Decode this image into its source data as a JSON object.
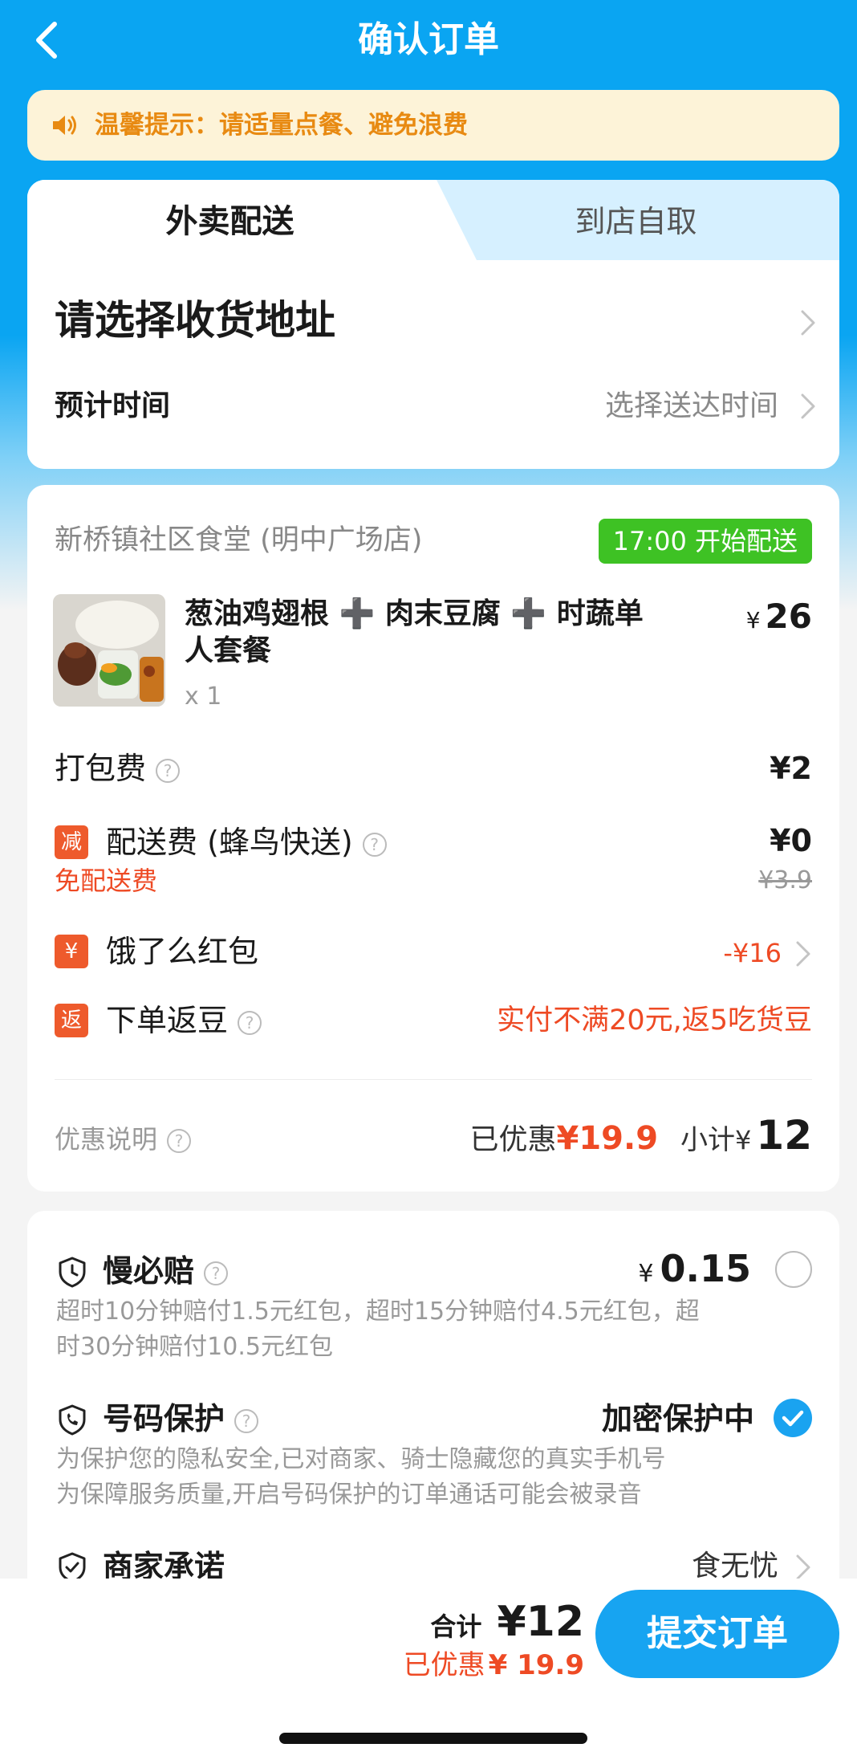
{
  "header": {
    "title": "确认订单",
    "back_icon": "chevron-left-icon"
  },
  "notice": {
    "icon": "speaker-icon",
    "text": "温馨提示：请适量点餐、避免浪费"
  },
  "delivery_tabs": {
    "delivery": "外卖配送",
    "pickup": "到店自取",
    "selected": "delivery"
  },
  "address": {
    "placeholder": "请选择收货地址"
  },
  "eta": {
    "label": "预计时间",
    "value": "选择送达时间"
  },
  "order": {
    "store_name": "新桥镇社区食堂 (明中广场店)",
    "ship_badge": "17:00 开始配送",
    "item": {
      "name": "葱油鸡翅根 ➕ 肉末豆腐 ➕ 时蔬单人套餐",
      "qty": "x 1",
      "currency": "¥",
      "price": "26"
    },
    "packing": {
      "label": "打包费",
      "value": "¥2"
    },
    "delivery_fee": {
      "tag": "减",
      "label": "配送费 (蜂鸟快送)",
      "value": "¥0",
      "note": "免配送费",
      "original": "¥3.9"
    },
    "red_packet": {
      "tag": "¥",
      "label": "饿了么红包",
      "value": "-¥16"
    },
    "beans": {
      "tag": "返",
      "label": "下单返豆",
      "value": "实付不满20元,返5吃货豆"
    },
    "discount_info_label": "优惠说明",
    "discounted_label": "已优惠",
    "discounted_value": "¥19.9",
    "subtotal_label": "小计",
    "subtotal_currency": "¥",
    "subtotal_value": "12"
  },
  "services": {
    "late_comp": {
      "icon": "clock-shield-icon",
      "title": "慢必赔",
      "currency": "¥",
      "price": "0.15",
      "selected": false,
      "desc_line1": "超时10分钟赔付1.5元红包，超时15分钟赔付4.5元红包，超",
      "desc_line2": "时30分钟赔付10.5元红包"
    },
    "number_protect": {
      "icon": "phone-shield-icon",
      "title": "号码保护",
      "status": "加密保护中",
      "selected": true,
      "desc_line1": "为保护您的隐私安全,已对商家、骑士隐藏您的真实手机号",
      "desc_line2": "为保障服务质量,开启号码保护的订单通话可能会被录音"
    },
    "merchant_promise": {
      "icon": "check-shield-icon",
      "title": "商家承诺",
      "value": "食无忧"
    }
  },
  "footer": {
    "total_label": "合计",
    "total_value": "¥12",
    "discount_label": "已优惠",
    "discount_value": "¥ 19.9",
    "submit": "提交订单"
  },
  "colors": {
    "brand_blue": "#0aa5f2",
    "accent_red": "#ee4a24",
    "badge_green": "#3ec224",
    "notice_orange": "#e88a12"
  }
}
